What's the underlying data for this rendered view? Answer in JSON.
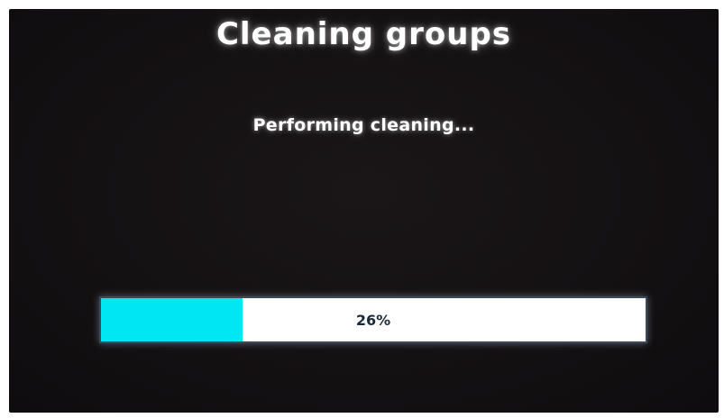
{
  "screen": {
    "title": "Cleaning groups",
    "status_text": "Performing cleaning..."
  },
  "progress": {
    "fraction": 0.26,
    "label": "26%",
    "fill_color": "#00e6f2",
    "track_color": "#ffffff"
  }
}
